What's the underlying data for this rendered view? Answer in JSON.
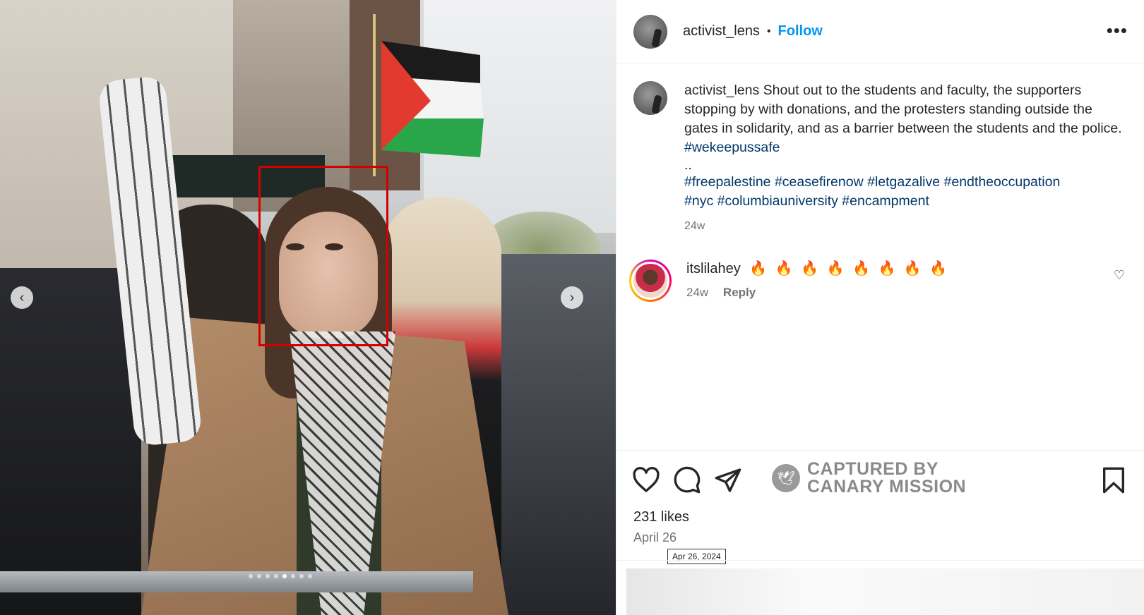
{
  "post": {
    "image_alt": "Protester holding a keffiyeh at a rally with a Palestinian flag in the background",
    "carousel": {
      "prev_label": "‹",
      "next_label": "›",
      "slide_count": 8,
      "active_slide": 4
    }
  },
  "header": {
    "username": "activist_lens",
    "separator": "•",
    "follow_label": "Follow",
    "more_label": "•••"
  },
  "caption": {
    "username": "activist_lens",
    "text": "Shout out to the students and faculty, the supporters stopping by with donations, and the protesters standing outside the gates in solidarity, and as a barrier between the students and the police.",
    "tag_inline": "#wekeepussafe",
    "dots": "..",
    "tags_line1": [
      "#freepalestine",
      "#ceasefirenow",
      "#letgazalive",
      "#endtheoccupation"
    ],
    "tags_line2": [
      "#nyc",
      "#columbiauniversity",
      "#encampment"
    ],
    "age": "24w"
  },
  "comment": {
    "username": "itslilahey",
    "text": "🔥 🔥 🔥 🔥 🔥 🔥 🔥 🔥",
    "age": "24w",
    "reply_label": "Reply",
    "like_icon": "♡"
  },
  "actions": {
    "like_icon": "heart-icon",
    "comment_icon": "comment-icon",
    "share_icon": "send-icon",
    "save_icon": "bookmark-icon",
    "watermark_line1": "CAPTURED BY",
    "watermark_line2": "CANARY MISSION"
  },
  "stats": {
    "likes": "231 likes",
    "date": "April 26",
    "date_tooltip": "Apr 26, 2024"
  },
  "colors": {
    "follow_blue": "#0095f6",
    "hashtag_navy": "#00376b",
    "highlight_red": "#d40000",
    "muted_text": "#737373"
  }
}
